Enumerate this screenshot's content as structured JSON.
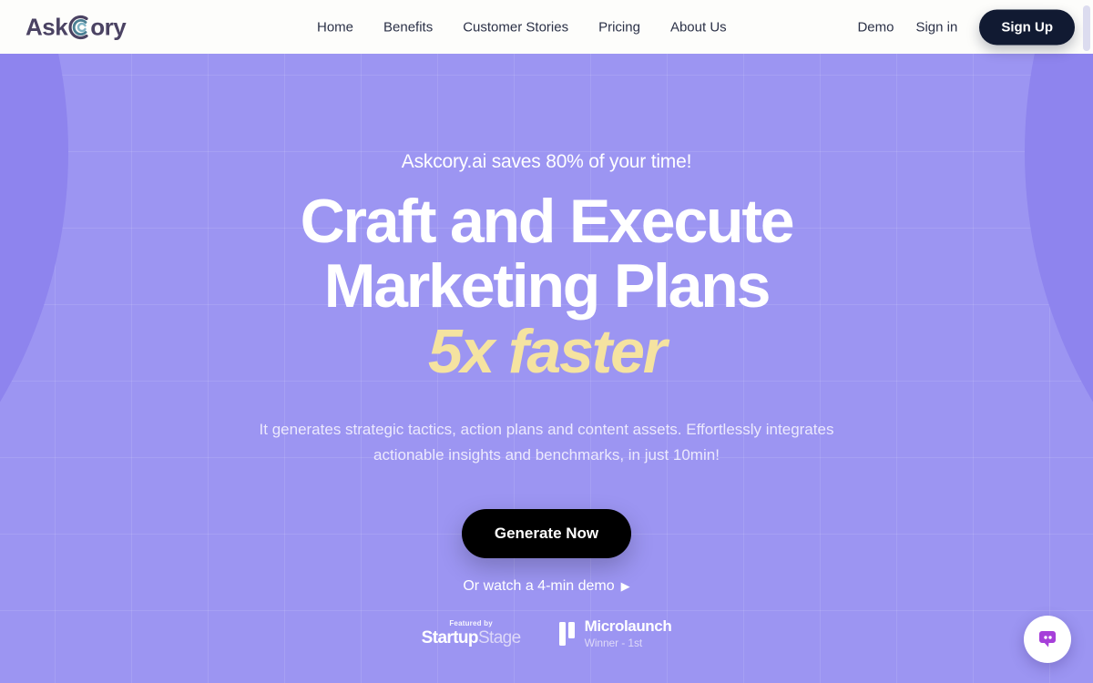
{
  "brand": {
    "name_part1": "Ask",
    "name_part2": "ory",
    "icon": "concentric-arc-c-icon"
  },
  "nav": {
    "items": [
      {
        "label": "Home"
      },
      {
        "label": "Benefits"
      },
      {
        "label": "Customer Stories"
      },
      {
        "label": "Pricing"
      },
      {
        "label": "About Us"
      }
    ],
    "demo_label": "Demo",
    "signin_label": "Sign in",
    "signup_label": "Sign Up"
  },
  "hero": {
    "tagline": "Askcory.ai saves 80% of your time!",
    "headline_line1": "Craft and Execute",
    "headline_line2": "Marketing Plans",
    "headline_accent": "5x faster",
    "subtext": "It generates strategic tactics, action plans and content assets. Effortlessly integrates actionable insights and benchmarks, in just 10min!",
    "cta_label": "Generate Now",
    "demo_link_label": "Or watch a 4-min demo",
    "demo_link_icon": "play-triangle-icon"
  },
  "badges": {
    "startupstage": {
      "featured_label": "Featured by",
      "name_bold": "Startup",
      "name_light": "Stage"
    },
    "microlaunch": {
      "mark": "microlaunch-bars-icon",
      "title": "Microlaunch",
      "subtitle": "Winner - 1st"
    }
  },
  "chat": {
    "icon": "chat-bubble-icon"
  },
  "colors": {
    "background": "#9c95f2",
    "background_arc": "#8e84ee",
    "header_bg": "#fdfdfb",
    "accent_yellow": "#f5e3a0",
    "signup_bg": "#111a32",
    "cta_bg": "#000000",
    "logo_text": "#4b4363",
    "logo_arc": "#4a7f93",
    "chat_bubble": "#a63fd9"
  }
}
